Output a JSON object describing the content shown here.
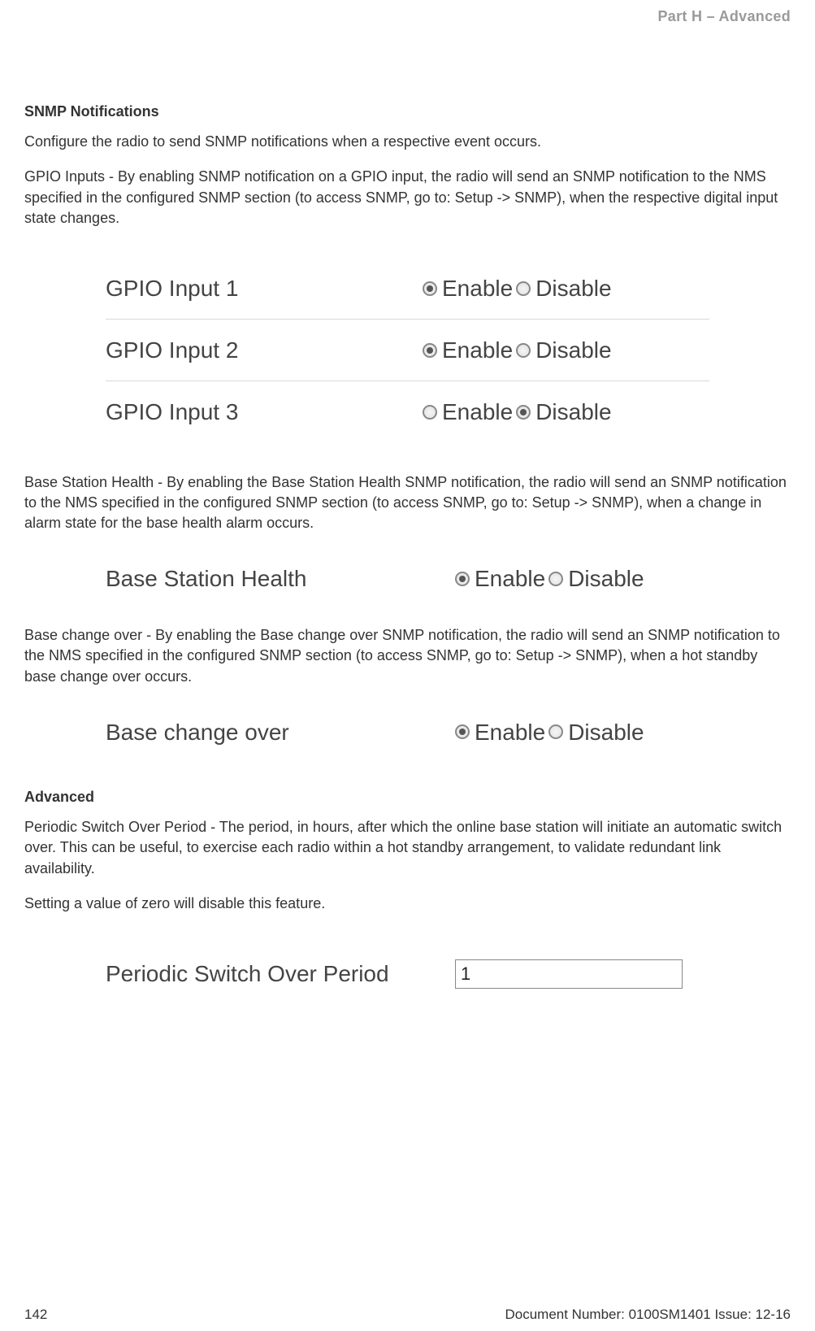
{
  "header": {
    "part_label": "Part H – Advanced"
  },
  "snmp": {
    "heading": "SNMP Notifications",
    "intro": "Configure the radio to send SNMP notifications when a respective event occurs.",
    "gpio_text": "GPIO Inputs - By enabling SNMP notification on a GPIO input, the radio will send an SNMP notification to the NMS specified in the configured SNMP section (to access SNMP, go to: Setup -> SNMP), when the respective digital input state changes.",
    "gpio_rows": [
      {
        "label": "GPIO Input 1",
        "enable_label": "Enable",
        "disable_label": "Disable",
        "selected": "enable"
      },
      {
        "label": "GPIO Input 2",
        "enable_label": "Enable",
        "disable_label": "Disable",
        "selected": "enable"
      },
      {
        "label": "GPIO Input 3",
        "enable_label": "Enable",
        "disable_label": "Disable",
        "selected": "disable"
      }
    ],
    "bsh_text": "Base Station Health - By enabling the Base Station Health SNMP notification, the radio will send an SNMP notification to the NMS specified in the configured SNMP section (to access SNMP, go to: Setup -> SNMP), when a change in alarm state for the base health alarm occurs.",
    "bsh_row": {
      "label": "Base Station Health",
      "enable_label": "Enable",
      "disable_label": "Disable",
      "selected": "enable"
    },
    "bco_text": "Base change over - By enabling the Base change over SNMP notification, the radio will send an SNMP notification to the NMS specified in the configured SNMP section (to access SNMP, go to: Setup -> SNMP), when a hot standby base change over occurs.",
    "bco_row": {
      "label": "Base change over",
      "enable_label": "Enable",
      "disable_label": "Disable",
      "selected": "enable"
    }
  },
  "advanced": {
    "heading": "Advanced",
    "psop_text": "Periodic Switch Over Period - The period, in hours, after which the online base station will initiate an automatic switch over. This can be useful, to exercise each radio within a hot standby arrangement, to validate redundant link availability.",
    "psop_zero": "Setting a value of zero will disable this feature.",
    "psop_row": {
      "label": "Periodic Switch Over Period",
      "value": "1"
    }
  },
  "footer": {
    "page": "142",
    "docinfo": "Document Number: 0100SM1401   Issue: 12-16"
  }
}
